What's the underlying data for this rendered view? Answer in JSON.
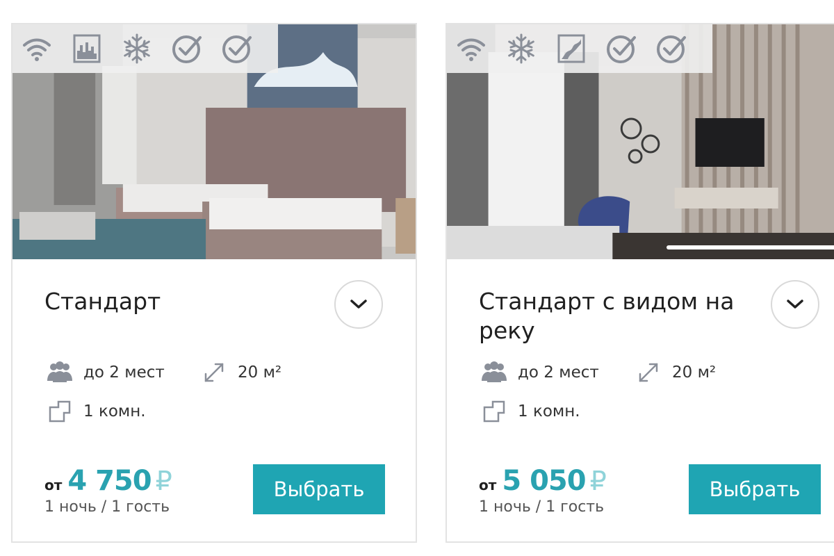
{
  "rooms": [
    {
      "title": "Стандарт",
      "capacity": "до 2 мест",
      "area": "20 м²",
      "rooms_count": "1 комн.",
      "price_from": "от",
      "price_value": "4 750",
      "currency": "₽",
      "price_note": "1 ночь / 1 гость",
      "select_label": "Выбрать",
      "amenities": [
        "wifi-icon",
        "city-view-icon",
        "air-conditioning-icon",
        "check-circle-icon",
        "check-circle-icon"
      ]
    },
    {
      "title": "Стандарт с видом на реку",
      "capacity": "до 2 мест",
      "area": "20 м²",
      "rooms_count": "1 комн.",
      "price_from": "от",
      "price_value": "5 050",
      "currency": "₽",
      "price_note": "1 ночь / 1 гость",
      "select_label": "Выбрать",
      "amenities": [
        "wifi-icon",
        "air-conditioning-icon",
        "river-view-icon",
        "check-circle-icon",
        "check-circle-icon"
      ]
    }
  ],
  "colors": {
    "accent": "#1fa5b3",
    "price": "#2aa2b0",
    "currency": "#8fd3d9",
    "icon": "#8a8f99"
  }
}
